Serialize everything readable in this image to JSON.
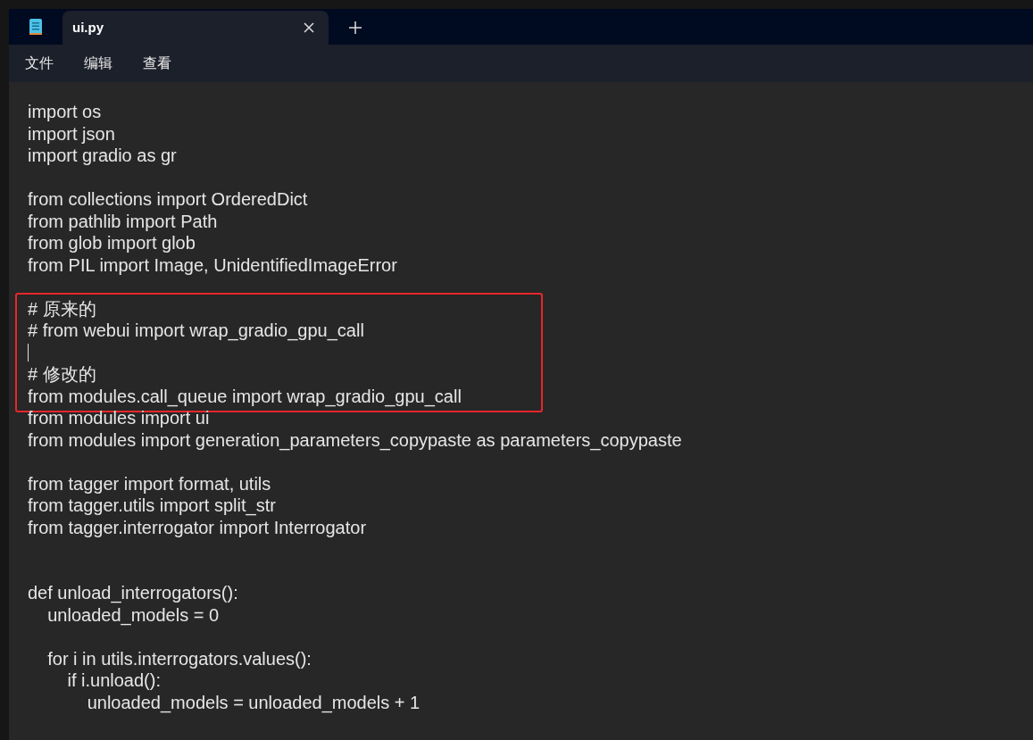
{
  "tabs": [
    {
      "label": "ui.py",
      "selected": true
    }
  ],
  "menu": [
    "文件",
    "编辑",
    "查看"
  ],
  "editor": {
    "blocks": [
      {
        "highlighted": false,
        "lines": [
          {
            "kind": "code",
            "text": "import os"
          },
          {
            "kind": "code",
            "text": "import json"
          },
          {
            "kind": "code",
            "text": "import gradio as gr"
          },
          {
            "kind": "blank"
          },
          {
            "kind": "code",
            "text": "from collections import OrderedDict"
          },
          {
            "kind": "code",
            "text": "from pathlib import Path"
          },
          {
            "kind": "code",
            "text": "from glob import glob"
          },
          {
            "kind": "code",
            "text": "from PIL import Image, UnidentifiedImageError"
          },
          {
            "kind": "blank"
          }
        ]
      },
      {
        "highlighted": true,
        "lines": [
          {
            "kind": "code",
            "text": "# 原来的"
          },
          {
            "kind": "code",
            "text": "# from webui import wrap_gradio_gpu_call"
          },
          {
            "kind": "cursor"
          },
          {
            "kind": "code",
            "text": "# 修改的"
          },
          {
            "kind": "code",
            "text": "from modules.call_queue import wrap_gradio_gpu_call"
          }
        ]
      },
      {
        "highlighted": false,
        "lines": [
          {
            "kind": "code",
            "text": "from modules import ui"
          },
          {
            "kind": "code",
            "text": "from modules import generation_parameters_copypaste as parameters_copypaste"
          },
          {
            "kind": "blank"
          },
          {
            "kind": "code",
            "text": "from tagger import format, utils"
          },
          {
            "kind": "code",
            "text": "from tagger.utils import split_str"
          },
          {
            "kind": "code",
            "text": "from tagger.interrogator import Interrogator"
          },
          {
            "kind": "blank"
          },
          {
            "kind": "blank"
          },
          {
            "kind": "code",
            "text": "def unload_interrogators():"
          },
          {
            "kind": "code",
            "text": "    unloaded_models = 0"
          },
          {
            "kind": "blank"
          },
          {
            "kind": "code",
            "text": "    for i in utils.interrogators.values():"
          },
          {
            "kind": "code",
            "text": "        if i.unload():"
          },
          {
            "kind": "code",
            "text": "            unloaded_models = unloaded_models + 1"
          }
        ]
      }
    ]
  }
}
